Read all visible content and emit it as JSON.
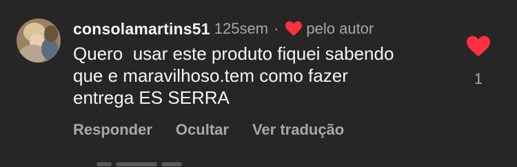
{
  "comment": {
    "username": "consolamartins51",
    "time": "125sem",
    "separator": "·",
    "liked_by_author": "pelo autor",
    "text": "Quero  usar este produto fiquei sabendo\nque e maravilhoso.tem como fazer\nentrega ES SERRA",
    "like_count": "1"
  },
  "actions": {
    "reply": "Responder",
    "hide": "Ocultar",
    "translate": "Ver tradução"
  },
  "icons": {
    "author_like": "heart-icon",
    "like_button": "heart-filled-icon"
  },
  "colors": {
    "background": "#262626",
    "primary_text": "#f5f5f5",
    "secondary_text": "#a8a8a8",
    "heart": "#ff3040"
  }
}
